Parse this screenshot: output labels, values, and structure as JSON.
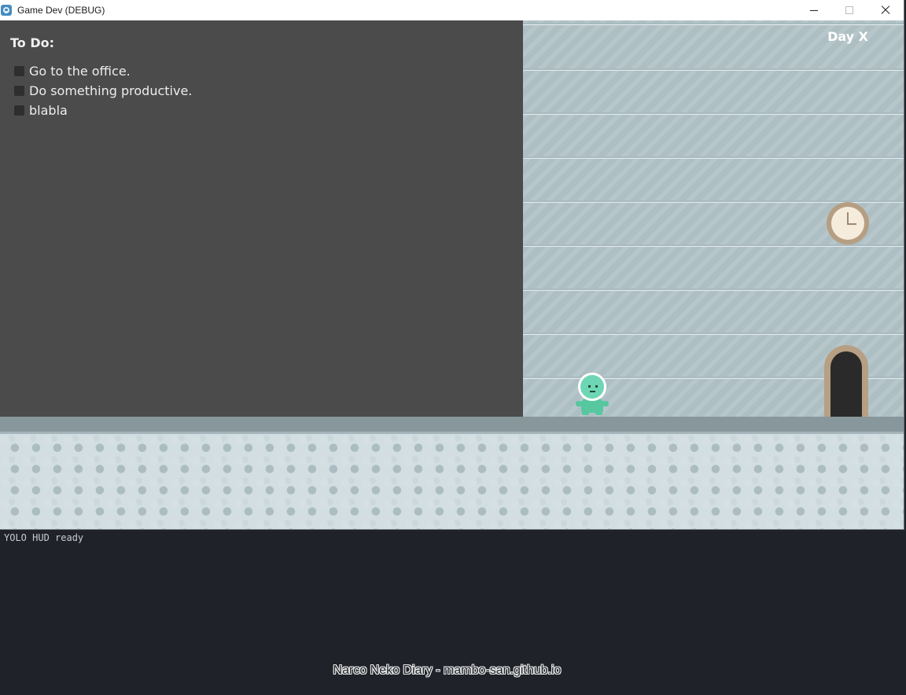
{
  "window": {
    "title": "Game Dev (DEBUG)",
    "controls": {
      "minimize_icon": "minimize-icon",
      "maximize_icon": "maximize-icon",
      "close_icon": "close-icon"
    }
  },
  "todo": {
    "title": "To Do:",
    "items": [
      {
        "label": "Go to the office.",
        "checked": false
      },
      {
        "label": "Do something productive.",
        "checked": false
      },
      {
        "label": "blabla",
        "checked": false
      }
    ]
  },
  "scene": {
    "day_label": "Day X",
    "objects": [
      "wall-clock-icon",
      "door-icon",
      "player-character"
    ]
  },
  "hud": {
    "status": "YOLO HUD ready"
  },
  "footer": {
    "credit": "Narco Neko Diary - mambo-san.github.io"
  }
}
